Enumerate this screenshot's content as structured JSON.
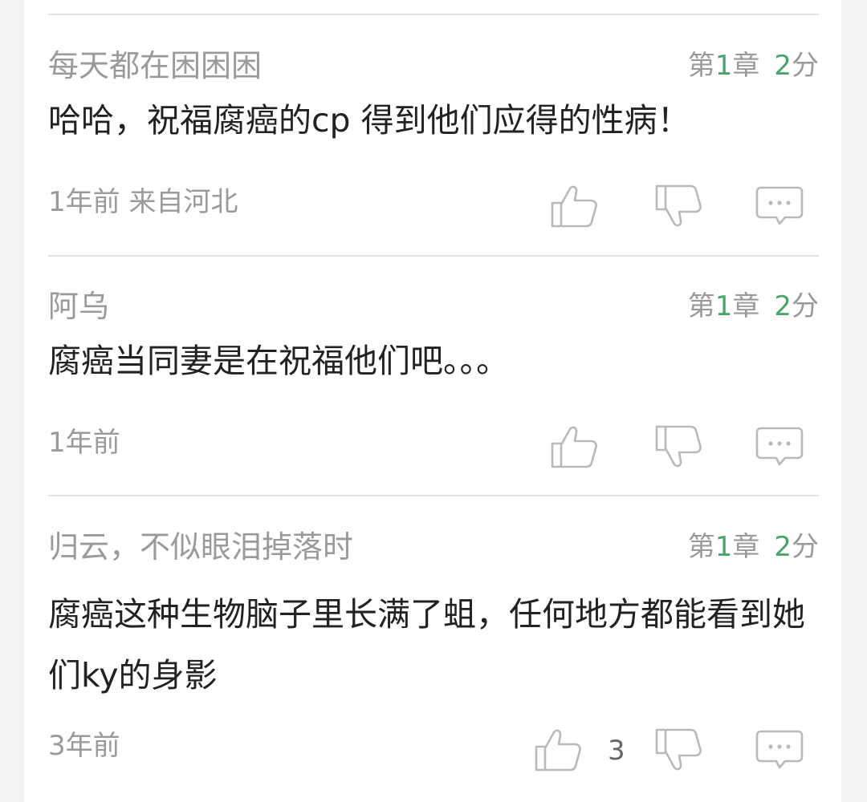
{
  "comments": [
    {
      "user": "每天都在困困困",
      "chapter_prefix": "第",
      "chapter_num": "1",
      "chapter_suffix": "章",
      "score": "2",
      "score_unit": "分",
      "text": "哈哈，祝福腐癌的cp 得到他们应得的性病！",
      "time": "1年前  来自河北",
      "likes": ""
    },
    {
      "user": "阿乌",
      "chapter_prefix": "第",
      "chapter_num": "1",
      "chapter_suffix": "章",
      "score": "2",
      "score_unit": "分",
      "text": "腐癌当同妻是在祝福他们吧。。。",
      "time": "1年前",
      "likes": ""
    },
    {
      "user": "归云，不似眼泪掉落时",
      "chapter_prefix": "第",
      "chapter_num": "1",
      "chapter_suffix": "章",
      "score": "2",
      "score_unit": "分",
      "text": "腐癌这种生物脑子里长满了蛆，任何地方都能看到她们ky的身影",
      "time": "3年前",
      "likes": "3"
    }
  ],
  "icons": {
    "like": "thumbs-up-icon",
    "dislike": "thumbs-down-icon",
    "reply": "comment-bubble-icon"
  },
  "colors": {
    "accent": "#4aa46c",
    "muted_text": "#9a9a9a",
    "body_text": "#222222"
  }
}
